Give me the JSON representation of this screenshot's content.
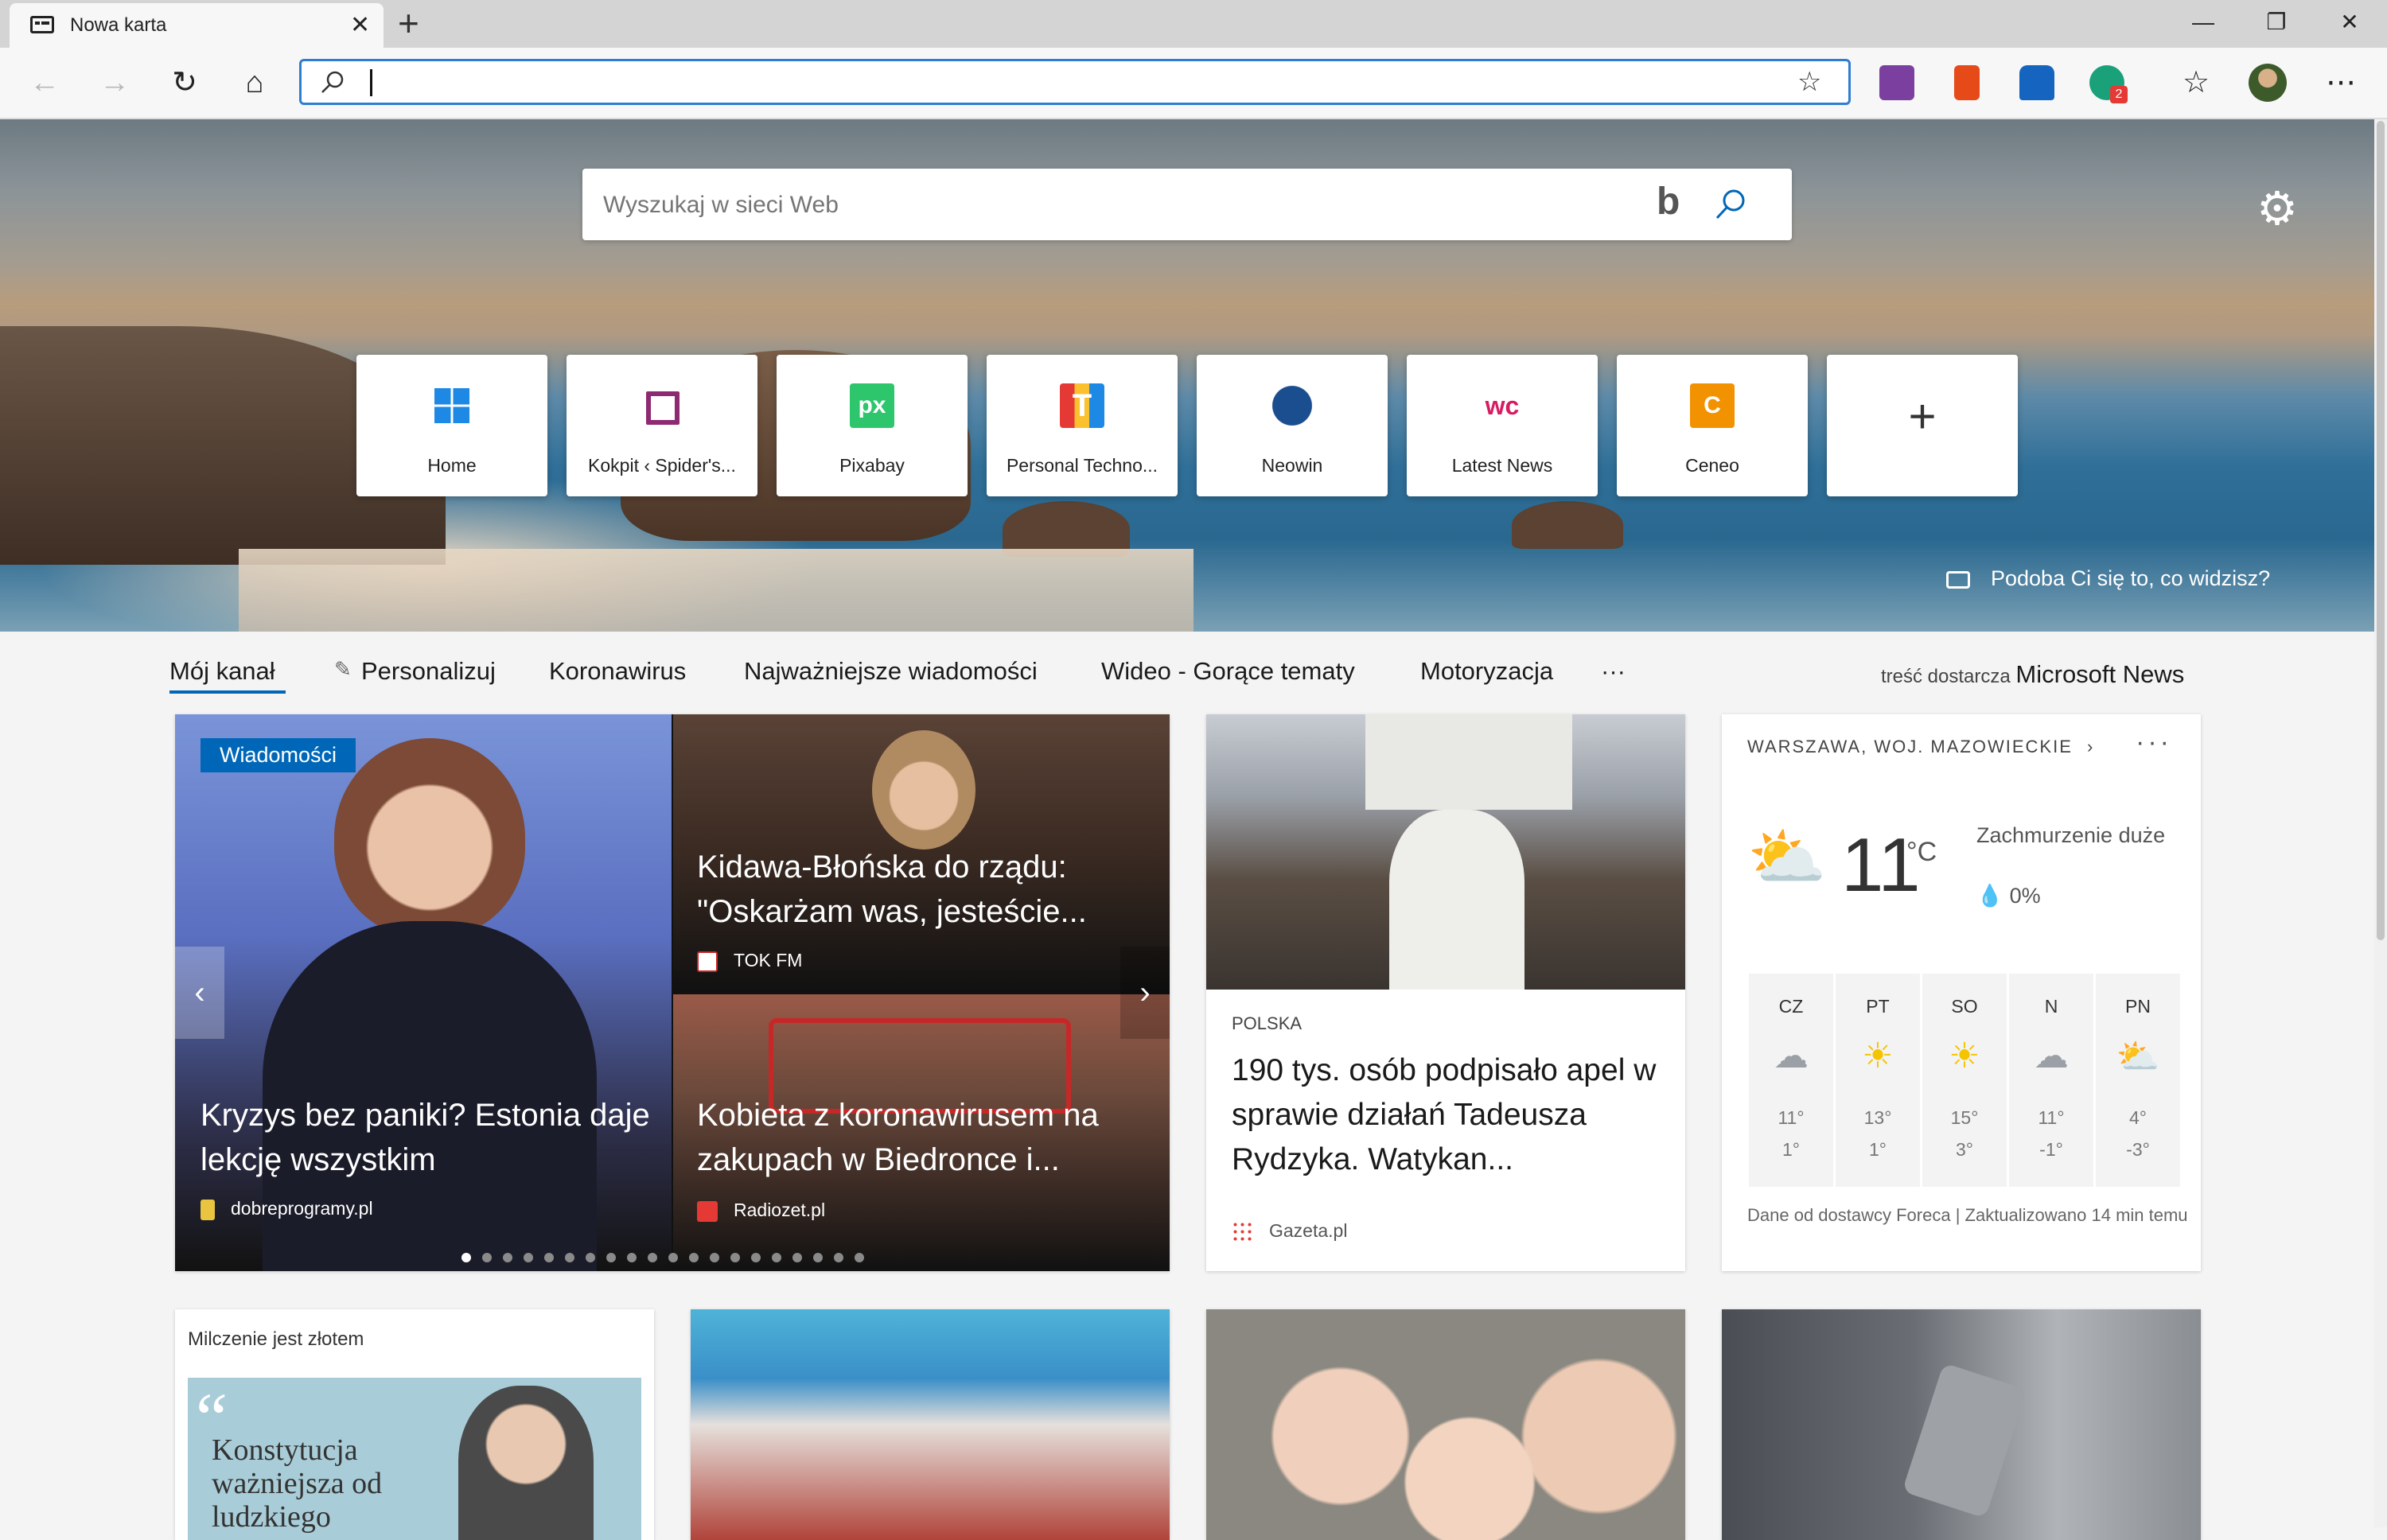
{
  "browser": {
    "tab_title": "Nowa karta",
    "tab_close": "✕",
    "new_tab": "+",
    "window": {
      "minimize": "—",
      "maximize": "❐",
      "close": "✕"
    },
    "address_value": "",
    "menu": "⋯"
  },
  "newtab": {
    "search_placeholder": "Wyszukaj w sieci Web",
    "bing_logo": "b",
    "quick_links": [
      {
        "label": "Home",
        "icon": "windows-icon",
        "glyph": "",
        "color": "#1e88e5"
      },
      {
        "label": "Kokpit ‹ Spider's...",
        "icon": "speech-bubble-icon",
        "glyph": "",
        "color": "#8e2a72"
      },
      {
        "label": "Pixabay",
        "icon": "pixabay-icon",
        "glyph": "px",
        "color": "#2ec66d"
      },
      {
        "label": "Personal Techno...",
        "icon": "letter-t-icon",
        "glyph": "T",
        "color": "#e53935"
      },
      {
        "label": "Neowin",
        "icon": "neowin-icon",
        "glyph": "",
        "color": "#1b4e8f"
      },
      {
        "label": "Latest News",
        "icon": "wc-icon",
        "glyph": "wc",
        "color": "#d81b60"
      },
      {
        "label": "Ceneo",
        "icon": "ceneo-icon",
        "glyph": "C",
        "color": "#f39200"
      },
      {
        "label": "",
        "icon": "plus-icon",
        "glyph": "+",
        "color": "#333333"
      }
    ],
    "photo_question": "Podoba Ci się to, co widzisz?"
  },
  "feed": {
    "nav": [
      "Mój kanał",
      "Personalizuj",
      "Koronawirus",
      "Najważniejsze wiadomości",
      "Wideo - Gorące tematy",
      "Motoryzacja",
      "···"
    ],
    "provider_prefix": "treść dostarcza",
    "provider_name": "Microsoft News",
    "carousel": {
      "badge": "Wiadomości",
      "main": {
        "title": "Kryzys bez paniki? Estonia daje lekcję wszystkim",
        "source": "dobreprogramy.pl"
      },
      "top": {
        "title": "Kidawa-Błońska do rządu: \"Oskarżam was, jesteście...",
        "source": "TOK FM"
      },
      "bottom": {
        "title": "Kobieta z koronawirusem na zakupach w Biedronce i...",
        "source": "Radiozet.pl"
      },
      "dots": 20,
      "active_dot": 0
    },
    "article": {
      "category": "POLSKA",
      "title": "190 tys. osób podpisało apel w sprawie działań Tadeusza Rydzyka. Watykan...",
      "source": "Gazeta.pl"
    },
    "weather": {
      "location": "WARSZAWA, WOJ. MAZOWIECKIE",
      "temp": "11",
      "unit": "°C",
      "condition": "Zachmurzenie duże",
      "precip": "0%",
      "days": [
        {
          "day": "CZ",
          "icon": "cloud-icon",
          "glyph": "☁",
          "high": "11°",
          "low": "1°"
        },
        {
          "day": "PT",
          "icon": "sun-icon",
          "glyph": "☀",
          "high": "13°",
          "low": "1°"
        },
        {
          "day": "SO",
          "icon": "sun-icon",
          "glyph": "☀",
          "high": "15°",
          "low": "3°"
        },
        {
          "day": "N",
          "icon": "cloud-icon",
          "glyph": "☁",
          "high": "11°",
          "low": "-1°"
        },
        {
          "day": "PN",
          "icon": "partly-cloudy-icon",
          "glyph": "⛅",
          "high": "4°",
          "low": "-3°"
        }
      ],
      "footer": "Dane od dostawcy Foreca | Zaktualizowano 14 min temu"
    },
    "row2": {
      "card1_header": "Milczenie jest złotem",
      "card1_quote": "Konstytucja ważniejsza od ludzkiego"
    }
  }
}
